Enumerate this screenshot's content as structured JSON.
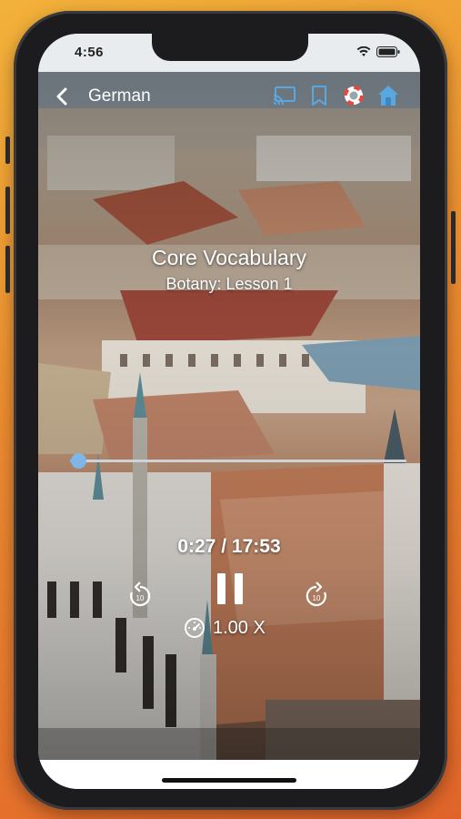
{
  "status_bar": {
    "time": "4:56"
  },
  "nav": {
    "back_icon": "chevron-left-icon",
    "title": "German",
    "icons": [
      "cast-icon",
      "bookmark-icon",
      "help-lifebuoy-icon",
      "home-icon"
    ]
  },
  "lesson": {
    "title": "Core Vocabulary",
    "subtitle": "Botany: Lesson 1"
  },
  "player": {
    "elapsed": "0:27",
    "duration": "17:53",
    "time_display": "0:27 / 17:53",
    "progress_fraction": 0.025,
    "rewind_seconds": "10",
    "forward_seconds": "10",
    "speed_label": "1.00 X"
  },
  "colors": {
    "accent": "#7fb6e8",
    "home_icon": "#5aa7e0",
    "lifebuoy": "#e8463a"
  }
}
